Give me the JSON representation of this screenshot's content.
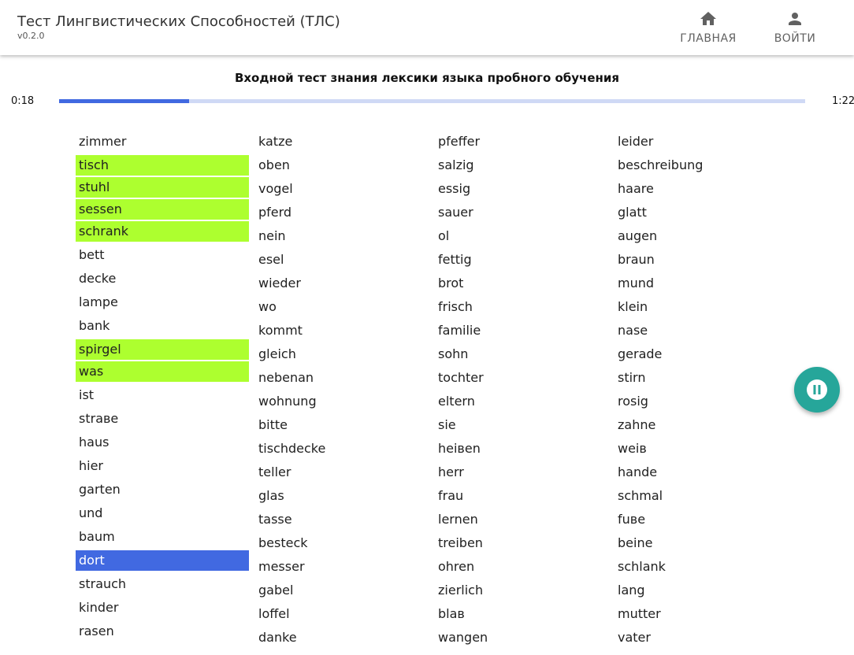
{
  "header": {
    "title": "Тест Лингвистических Способностей (ТЛС)",
    "version": "v0.2.0",
    "nav": [
      {
        "label": "ГЛАВНАЯ",
        "icon": "home-icon"
      },
      {
        "label": "ВОЙТИ",
        "icon": "person-icon"
      }
    ]
  },
  "test": {
    "title": "Входной тест знания лексики языка пробного обучения",
    "elapsed": "0:18",
    "total": "1:22",
    "progress": 0.174
  },
  "colors": {
    "selected_green": "#adff2f",
    "selected_blue": "#4169e1",
    "fab": "#26a69a"
  },
  "fab": {
    "icon": "pause-icon"
  },
  "columns": [
    [
      {
        "word": "zimmer",
        "state": "none"
      },
      {
        "word": "tisch",
        "state": "green"
      },
      {
        "word": "stuhl",
        "state": "green"
      },
      {
        "word": "sessen",
        "state": "green"
      },
      {
        "word": "schrank",
        "state": "green"
      },
      {
        "word": "bett",
        "state": "none"
      },
      {
        "word": "decke",
        "state": "none"
      },
      {
        "word": "lampe",
        "state": "none"
      },
      {
        "word": "bank",
        "state": "none"
      },
      {
        "word": "spirgel",
        "state": "green"
      },
      {
        "word": "was",
        "state": "green"
      },
      {
        "word": "ist",
        "state": "none"
      },
      {
        "word": "straве",
        "state": "none"
      },
      {
        "word": "haus",
        "state": "none"
      },
      {
        "word": "hier",
        "state": "none"
      },
      {
        "word": "garten",
        "state": "none"
      },
      {
        "word": "und",
        "state": "none"
      },
      {
        "word": "baum",
        "state": "none"
      },
      {
        "word": "dort",
        "state": "blue"
      },
      {
        "word": "strauch",
        "state": "none"
      },
      {
        "word": "kinder",
        "state": "none"
      },
      {
        "word": "rasen",
        "state": "none"
      }
    ],
    [
      {
        "word": "katze",
        "state": "none"
      },
      {
        "word": "oben",
        "state": "none"
      },
      {
        "word": "vogel",
        "state": "none"
      },
      {
        "word": "pferd",
        "state": "none"
      },
      {
        "word": "nein",
        "state": "none"
      },
      {
        "word": "esel",
        "state": "none"
      },
      {
        "word": "wieder",
        "state": "none"
      },
      {
        "word": "wo",
        "state": "none"
      },
      {
        "word": "kommt",
        "state": "none"
      },
      {
        "word": "gleich",
        "state": "none"
      },
      {
        "word": "nebenan",
        "state": "none"
      },
      {
        "word": "wohnung",
        "state": "none"
      },
      {
        "word": "bitte",
        "state": "none"
      },
      {
        "word": "tischdecke",
        "state": "none"
      },
      {
        "word": "teller",
        "state": "none"
      },
      {
        "word": "glas",
        "state": "none"
      },
      {
        "word": "tasse",
        "state": "none"
      },
      {
        "word": "besteck",
        "state": "none"
      },
      {
        "word": "messer",
        "state": "none"
      },
      {
        "word": "gabel",
        "state": "none"
      },
      {
        "word": "loffel",
        "state": "none"
      },
      {
        "word": "danke",
        "state": "none"
      }
    ],
    [
      {
        "word": "pfeffer",
        "state": "none"
      },
      {
        "word": "salzig",
        "state": "none"
      },
      {
        "word": "essig",
        "state": "none"
      },
      {
        "word": "sauer",
        "state": "none"
      },
      {
        "word": "ol",
        "state": "none"
      },
      {
        "word": "fettig",
        "state": "none"
      },
      {
        "word": "brot",
        "state": "none"
      },
      {
        "word": "frisch",
        "state": "none"
      },
      {
        "word": "familie",
        "state": "none"
      },
      {
        "word": "sohn",
        "state": "none"
      },
      {
        "word": "tochter",
        "state": "none"
      },
      {
        "word": "eltern",
        "state": "none"
      },
      {
        "word": "sie",
        "state": "none"
      },
      {
        "word": "heiвen",
        "state": "none"
      },
      {
        "word": "herr",
        "state": "none"
      },
      {
        "word": "frau",
        "state": "none"
      },
      {
        "word": "lernen",
        "state": "none"
      },
      {
        "word": "treiben",
        "state": "none"
      },
      {
        "word": "ohren",
        "state": "none"
      },
      {
        "word": "zierlich",
        "state": "none"
      },
      {
        "word": "blaв",
        "state": "none"
      },
      {
        "word": "wangen",
        "state": "none"
      }
    ],
    [
      {
        "word": "leider",
        "state": "none"
      },
      {
        "word": "beschreibung",
        "state": "none"
      },
      {
        "word": "haare",
        "state": "none"
      },
      {
        "word": "glatt",
        "state": "none"
      },
      {
        "word": "augen",
        "state": "none"
      },
      {
        "word": "braun",
        "state": "none"
      },
      {
        "word": "mund",
        "state": "none"
      },
      {
        "word": "klein",
        "state": "none"
      },
      {
        "word": "nase",
        "state": "none"
      },
      {
        "word": "gerade",
        "state": "none"
      },
      {
        "word": "stirn",
        "state": "none"
      },
      {
        "word": "rosig",
        "state": "none"
      },
      {
        "word": "zahne",
        "state": "none"
      },
      {
        "word": "weiв",
        "state": "none"
      },
      {
        "word": "hande",
        "state": "none"
      },
      {
        "word": "schmal",
        "state": "none"
      },
      {
        "word": "fuве",
        "state": "none"
      },
      {
        "word": "beine",
        "state": "none"
      },
      {
        "word": "schlank",
        "state": "none"
      },
      {
        "word": "lang",
        "state": "none"
      },
      {
        "word": "mutter",
        "state": "none"
      },
      {
        "word": "vater",
        "state": "none"
      }
    ]
  ]
}
